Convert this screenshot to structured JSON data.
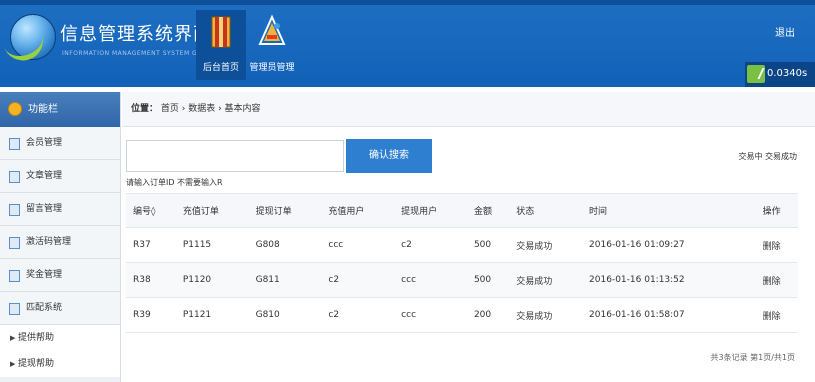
{
  "header": {
    "title": "信息管理系统界面",
    "subtitle": "INFORMATION MANAGEMENT SYSTEM GUI",
    "nav_tabs": [
      {
        "label": "后台首页",
        "active": true,
        "icon": "book-icon"
      },
      {
        "label": "管理员管理",
        "active": false,
        "icon": "admin-icon"
      }
    ],
    "logout_label": "退出",
    "timer_text": "0.0340s"
  },
  "sidebar": {
    "title": "功能栏",
    "items": [
      {
        "label": "会员管理"
      },
      {
        "label": "文章管理"
      },
      {
        "label": "留言管理"
      },
      {
        "label": "激活码管理"
      },
      {
        "label": "奖金管理"
      },
      {
        "label": "匹配系统"
      }
    ],
    "subitems": [
      {
        "label": "提供帮助"
      },
      {
        "label": "提现帮助"
      }
    ]
  },
  "breadcrumb": {
    "prefix": "位置：",
    "path": "首页 › 数据表 › 基本内容"
  },
  "search": {
    "placeholder": "",
    "button_label": "确认搜索",
    "hint": "请输入订单ID 不需要输入R"
  },
  "status_links": "交易中 交易成功",
  "table": {
    "columns": [
      "编号◊",
      "充值订单",
      "提现订单",
      "充值用户",
      "提现用户",
      "金额",
      "状态",
      "时间",
      "操作"
    ],
    "rows": [
      [
        "R37",
        "P1115",
        "G808",
        "ccc",
        "c2",
        "500",
        "交易成功",
        "2016-01-16 01:09:27",
        "删除"
      ],
      [
        "R38",
        "P1120",
        "G811",
        "c2",
        "ccc",
        "500",
        "交易成功",
        "2016-01-16 01:13:52",
        "删除"
      ],
      [
        "R39",
        "P1121",
        "G810",
        "c2",
        "ccc",
        "200",
        "交易成功",
        "2016-01-16 01:58:07",
        "删除"
      ]
    ]
  },
  "pager": "共3条记录 第1页/共1页",
  "colors": {
    "header_bg": "#1565ba",
    "accent_blue": "#2e7fd0",
    "sidebar_bg": "#eef2f6"
  }
}
